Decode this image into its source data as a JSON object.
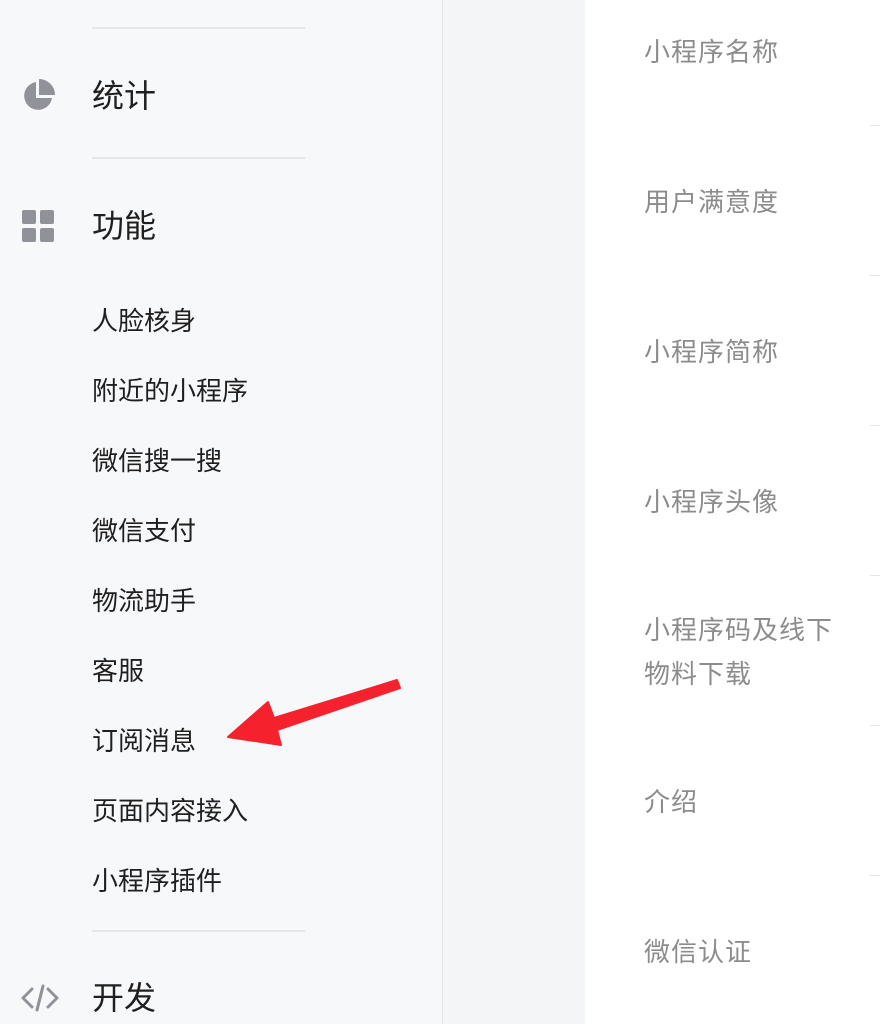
{
  "sidebar": {
    "sections": {
      "stats": {
        "label": "统计",
        "icon": "pie-chart-icon"
      },
      "features": {
        "label": "功能",
        "icon": "grid-icon"
      },
      "dev": {
        "label": "开发",
        "icon": "code-icon"
      }
    },
    "feature_items": [
      {
        "label": "人脸核身"
      },
      {
        "label": "附近的小程序"
      },
      {
        "label": "微信搜一搜"
      },
      {
        "label": "微信支付"
      },
      {
        "label": "物流助手"
      },
      {
        "label": "客服"
      },
      {
        "label": "订阅消息"
      },
      {
        "label": "页面内容接入"
      },
      {
        "label": "小程序插件"
      }
    ],
    "icon_color": "#8f9299"
  },
  "content": {
    "fields": [
      {
        "label": "小程序名称"
      },
      {
        "label": "用户满意度"
      },
      {
        "label": "小程序简称"
      },
      {
        "label": "小程序头像"
      },
      {
        "label": "小程序码及线下物料下载"
      },
      {
        "label": "介绍"
      },
      {
        "label": "微信认证"
      }
    ]
  },
  "annotation": {
    "arrow_color": "#f5222d",
    "points_to": "订阅消息"
  }
}
